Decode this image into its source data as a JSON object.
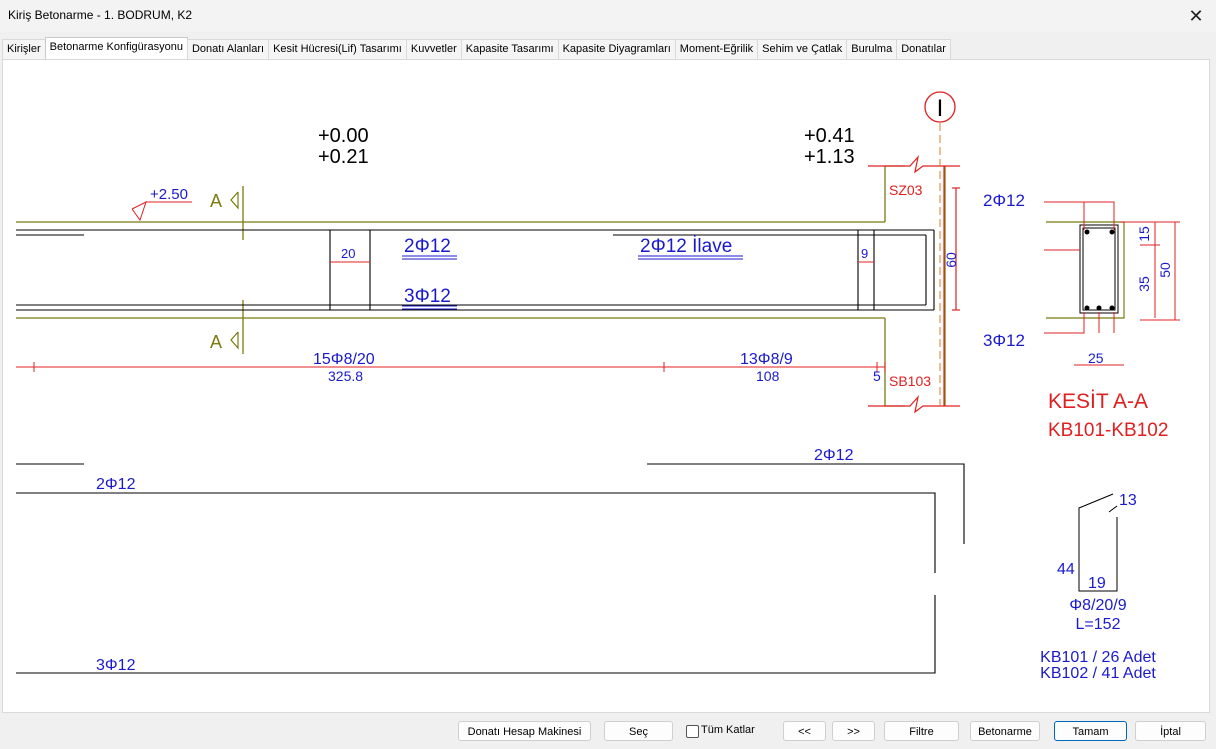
{
  "window": {
    "title": "Kiriş Betonarme - 1. BODRUM, K2",
    "close_glyph": "✕"
  },
  "tabs": [
    {
      "label": "Kirişler"
    },
    {
      "label": "Betonarme Konfigürasyonu",
      "active": true
    },
    {
      "label": "Donatı Alanları"
    },
    {
      "label": "Kesit Hücresi(Lif) Tasarımı"
    },
    {
      "label": "Kuvvetler"
    },
    {
      "label": "Kapasite Tasarımı"
    },
    {
      "label": "Kapasite Diyagramları"
    },
    {
      "label": "Moment-Eğrilik"
    },
    {
      "label": "Sehim ve Çatlak"
    },
    {
      "label": "Burulma"
    },
    {
      "label": "Donatılar"
    }
  ],
  "drawing": {
    "elev_left_1": "+0.00",
    "elev_left_2": "+0.21",
    "elev_right_1": "+0.41",
    "elev_right_2": "+1.13",
    "level_mark": "+2.50",
    "section_mark_top": "A",
    "section_mark_bottom": "A",
    "axis_label": "I",
    "column_top": "SZ03",
    "column_bottom": "SB103",
    "top_bar": "2Φ12",
    "top_extra_bar": "2Φ12 İlave",
    "bottom_bar": "3Φ12",
    "dim_left_bay": "20",
    "dim_right_bay": "9",
    "dim_height": "60",
    "stirrup_1": "15Φ8/20",
    "stirrup_1_len": "325.8",
    "stirrup_2": "13Φ8/9",
    "stirrup_2_len": "108",
    "dim_end": "5",
    "section": {
      "top_bar": "2Φ12",
      "bottom_bar": "3Φ12",
      "dim_15": "15",
      "dim_35": "35",
      "dim_50": "50",
      "dim_25": "25",
      "title": "KESİT A-A",
      "subtitle": "KB101-KB102"
    },
    "bars_detail": {
      "top_right": "2Φ12",
      "top_left": "2Φ12",
      "bottom": "3Φ12"
    },
    "stirrup_detail": {
      "hook": "13",
      "height": "44",
      "width": "19",
      "spec": "Φ8/20/9",
      "length": "L=152",
      "count_1": "KB101 / 26 Adet",
      "count_2": "KB102 / 41 Adet"
    }
  },
  "buttons": {
    "calc": "Donatı Hesap Makinesi",
    "select": "Seç",
    "all_floors": "Tüm Katlar",
    "prev": "<<",
    "next": ">>",
    "filter": "Filtre",
    "concrete": "Betonarme",
    "ok": "Tamam",
    "cancel": "İptal"
  },
  "colors": {
    "olive": "#7b7b10",
    "red": "#e02020",
    "blue": "#1a1acc",
    "black": "#000000",
    "orange": "#d4822a"
  }
}
